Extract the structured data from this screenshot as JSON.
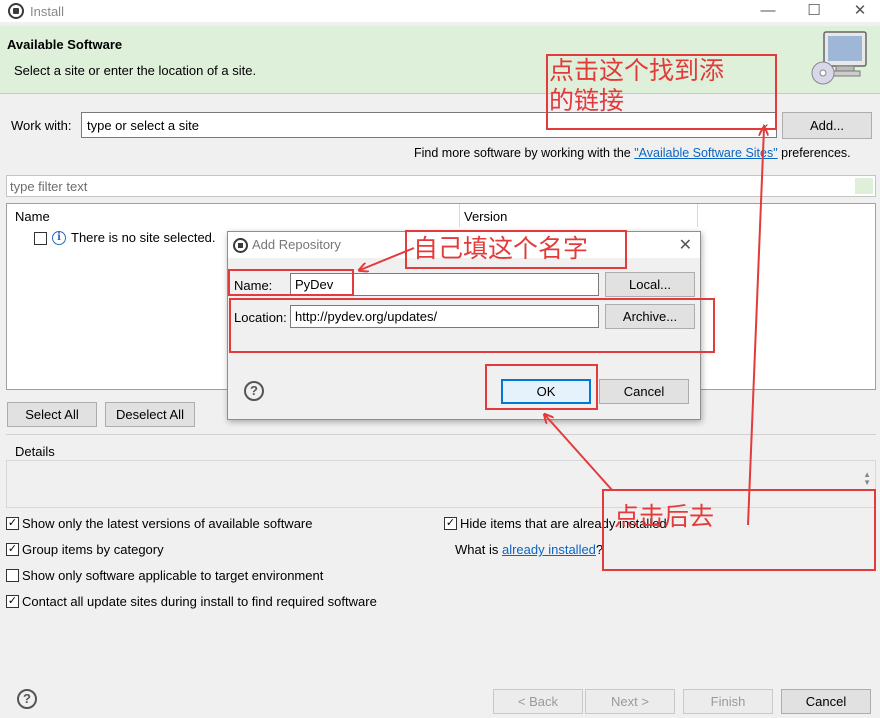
{
  "window": {
    "title": "Install"
  },
  "banner": {
    "title": "Available Software",
    "subtitle": "Select a site or enter the location of a site."
  },
  "work_with": {
    "label": "Work with:",
    "value": "type or select a site",
    "add_label": "Add...",
    "find_more_prefix": "Find more software by working with the ",
    "find_more_link": "\"Available Software Sites\"",
    "find_more_suffix": " preferences."
  },
  "filter": {
    "placeholder": "type filter text"
  },
  "table": {
    "columns": [
      "Name",
      "Version"
    ],
    "empty_message": "There is no site selected."
  },
  "selection_buttons": {
    "select_all": "Select All",
    "deselect_all": "Deselect All"
  },
  "details": {
    "label": "Details"
  },
  "options": {
    "show_latest": {
      "label": "Show only the latest versions of available software",
      "checked": true
    },
    "group_by_category": {
      "label": "Group items by category",
      "checked": true
    },
    "applicable_target": {
      "label": "Show only software applicable to target environment",
      "checked": false
    },
    "contact_all_sites": {
      "label": "Contact all update sites during install to find required software",
      "checked": true
    },
    "hide_installed": {
      "label": "Hide items that are already installed",
      "checked": true
    },
    "what_is_prefix": "What is ",
    "what_is_link": "already installed",
    "what_is_suffix": "?"
  },
  "footer": {
    "back": "< Back",
    "next": "Next >",
    "finish": "Finish",
    "cancel": "Cancel"
  },
  "dialog": {
    "title": "Add Repository",
    "name_label": "Name:",
    "name_value": "PyDev",
    "local_label": "Local...",
    "location_label": "Location:",
    "location_value": "http://pydev.org/updates/",
    "archive_label": "Archive...",
    "ok_label": "OK",
    "cancel_label": "Cancel"
  },
  "annotations": {
    "find_link_line1": "点击这个找到添",
    "find_link_line2": "的链接",
    "fill_name": "自己填这个名字",
    "click_after": "点击后去",
    "color": "#e33b3b"
  }
}
